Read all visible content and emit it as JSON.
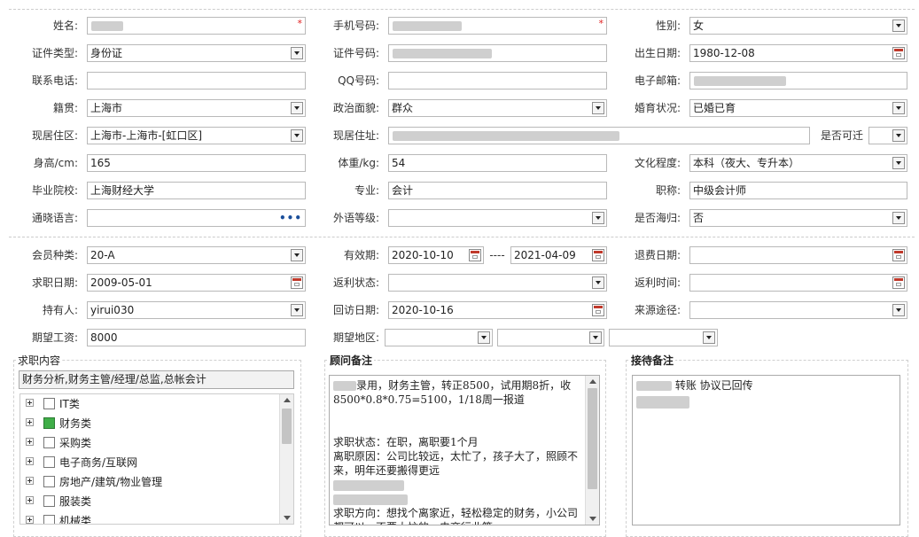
{
  "personal": {
    "name": {
      "label": "姓名:",
      "value": "",
      "required": "*"
    },
    "phone": {
      "label": "手机号码:",
      "value": "",
      "required": "*"
    },
    "gender": {
      "label": "性别:",
      "value": "女"
    },
    "id_type": {
      "label": "证件类型:",
      "value": "身份证"
    },
    "id_number": {
      "label": "证件号码:",
      "value": ""
    },
    "birth_date": {
      "label": "出生日期:",
      "value": "1980-12-08"
    },
    "contact_phone": {
      "label": "联系电话:",
      "value": ""
    },
    "qq": {
      "label": "QQ号码:",
      "value": ""
    },
    "email": {
      "label": "电子邮箱:",
      "value": ""
    },
    "native_place": {
      "label": "籍贯:",
      "value": "上海市"
    },
    "political_status": {
      "label": "政治面貌:",
      "value": "群众"
    },
    "marital_status": {
      "label": "婚育状况:",
      "value": "已婚已育"
    },
    "residence_area": {
      "label": "现居住区:",
      "value": "上海市-上海市-[虹口区]"
    },
    "residence_address": {
      "label": "现居住址:",
      "value": ""
    },
    "relocatable": {
      "label": "是否可迁",
      "value": ""
    },
    "height": {
      "label": "身高/cm:",
      "value": "165"
    },
    "weight": {
      "label": "体重/kg:",
      "value": "54"
    },
    "education": {
      "label": "文化程度:",
      "value": "本科（夜大、专升本）"
    },
    "school": {
      "label": "毕业院校:",
      "value": "上海财经大学"
    },
    "major": {
      "label": "专业:",
      "value": "会计"
    },
    "title": {
      "label": "职称:",
      "value": "中级会计师"
    },
    "languages": {
      "label": "通晓语言:",
      "value": ""
    },
    "foreign_level": {
      "label": "外语等级:",
      "value": ""
    },
    "returnee": {
      "label": "是否海归:",
      "value": "否"
    }
  },
  "membership": {
    "member_type": {
      "label": "会员种类:",
      "value": "20-A"
    },
    "validity": {
      "label": "有效期:",
      "from": "2020-10-10",
      "sep": "----",
      "to": "2021-04-09"
    },
    "refund_date": {
      "label": "退费日期:",
      "value": ""
    },
    "job_date": {
      "label": "求职日期:",
      "value": "2009-05-01"
    },
    "rebate_status": {
      "label": "返利状态:",
      "value": ""
    },
    "rebate_time": {
      "label": "返利时间:",
      "value": ""
    },
    "holder": {
      "label": "持有人:",
      "value": "yirui030"
    },
    "visit_date": {
      "label": "回访日期:",
      "value": "2020-10-16"
    },
    "source": {
      "label": "来源途径:",
      "value": ""
    },
    "expected_salary": {
      "label": "期望工资:",
      "value": "8000"
    },
    "expected_area": {
      "label": "期望地区:",
      "values": [
        "",
        "",
        ""
      ]
    }
  },
  "job_content": {
    "title": "求职内容",
    "summary": "财务分析,财务主管/经理/总监,总帐会计",
    "tree": [
      {
        "label": "IT类",
        "checked": false
      },
      {
        "label": "财务类",
        "checked": true
      },
      {
        "label": "采购类",
        "checked": false
      },
      {
        "label": "电子商务/互联网",
        "checked": false
      },
      {
        "label": "房地产/建筑/物业管理",
        "checked": false
      },
      {
        "label": "服装类",
        "checked": false
      },
      {
        "label": "机械类",
        "checked": false
      }
    ]
  },
  "consultant_notes": {
    "title": "顾问备注",
    "lines": [
      "录用，财务主管，转正8500，试用期8折，收",
      "8500*0.8*0.75=5100，1/18周一报道",
      "",
      "",
      "求职状态：在职，离职要1个月",
      "离职原因：公司比较远，太忙了，孩子大了，照顾不",
      "来，明年还要搬得更远",
      "",
      "",
      "求职方向：想找个离家近，轻松稳定的财务，小公司",
      "都可以。不要太忙的，电商行业等。"
    ]
  },
  "reception_notes": {
    "title": "接待备注",
    "text": "转账 协议已回传"
  }
}
